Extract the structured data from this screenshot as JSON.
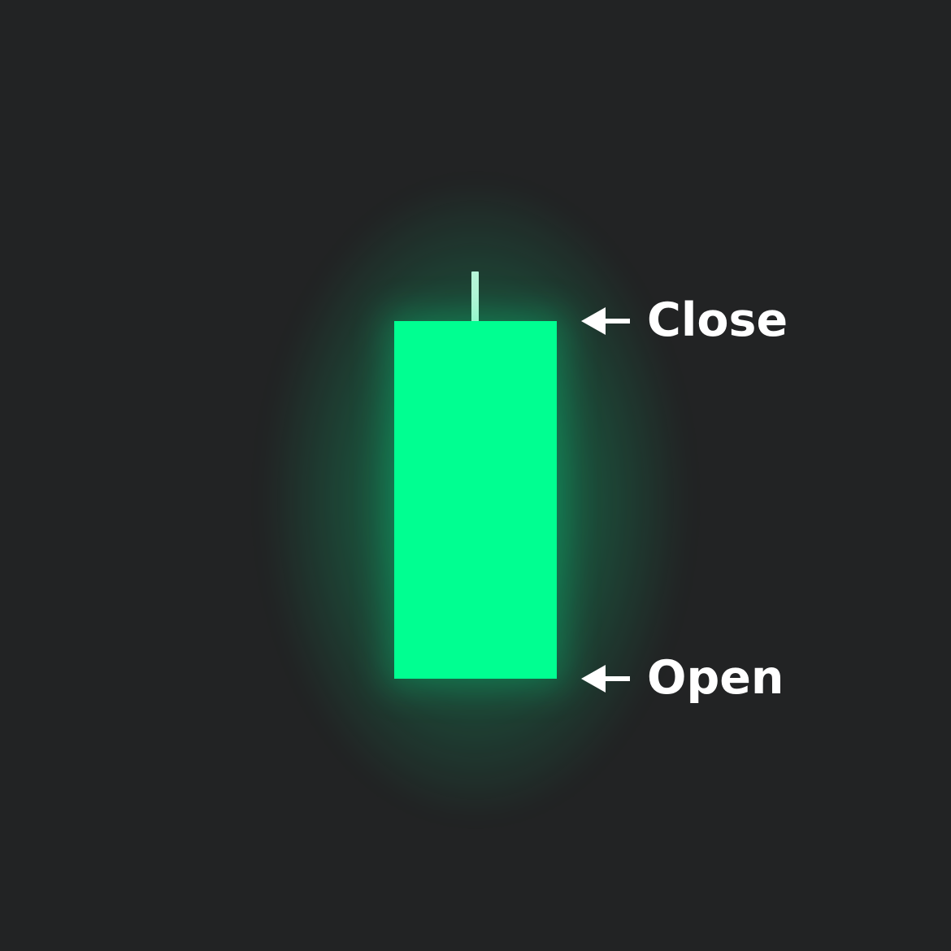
{
  "diagram": {
    "labels": {
      "close": "Close",
      "open": "Open"
    },
    "candle": {
      "direction": "bullish",
      "body_color": "#00FF91",
      "wick_color": "#B6F5D8"
    },
    "colors": {
      "background": "#222324",
      "label": "#FFFFFF"
    },
    "icons": {
      "close_arrow": "arrow-left-icon",
      "open_arrow": "arrow-left-icon"
    }
  }
}
